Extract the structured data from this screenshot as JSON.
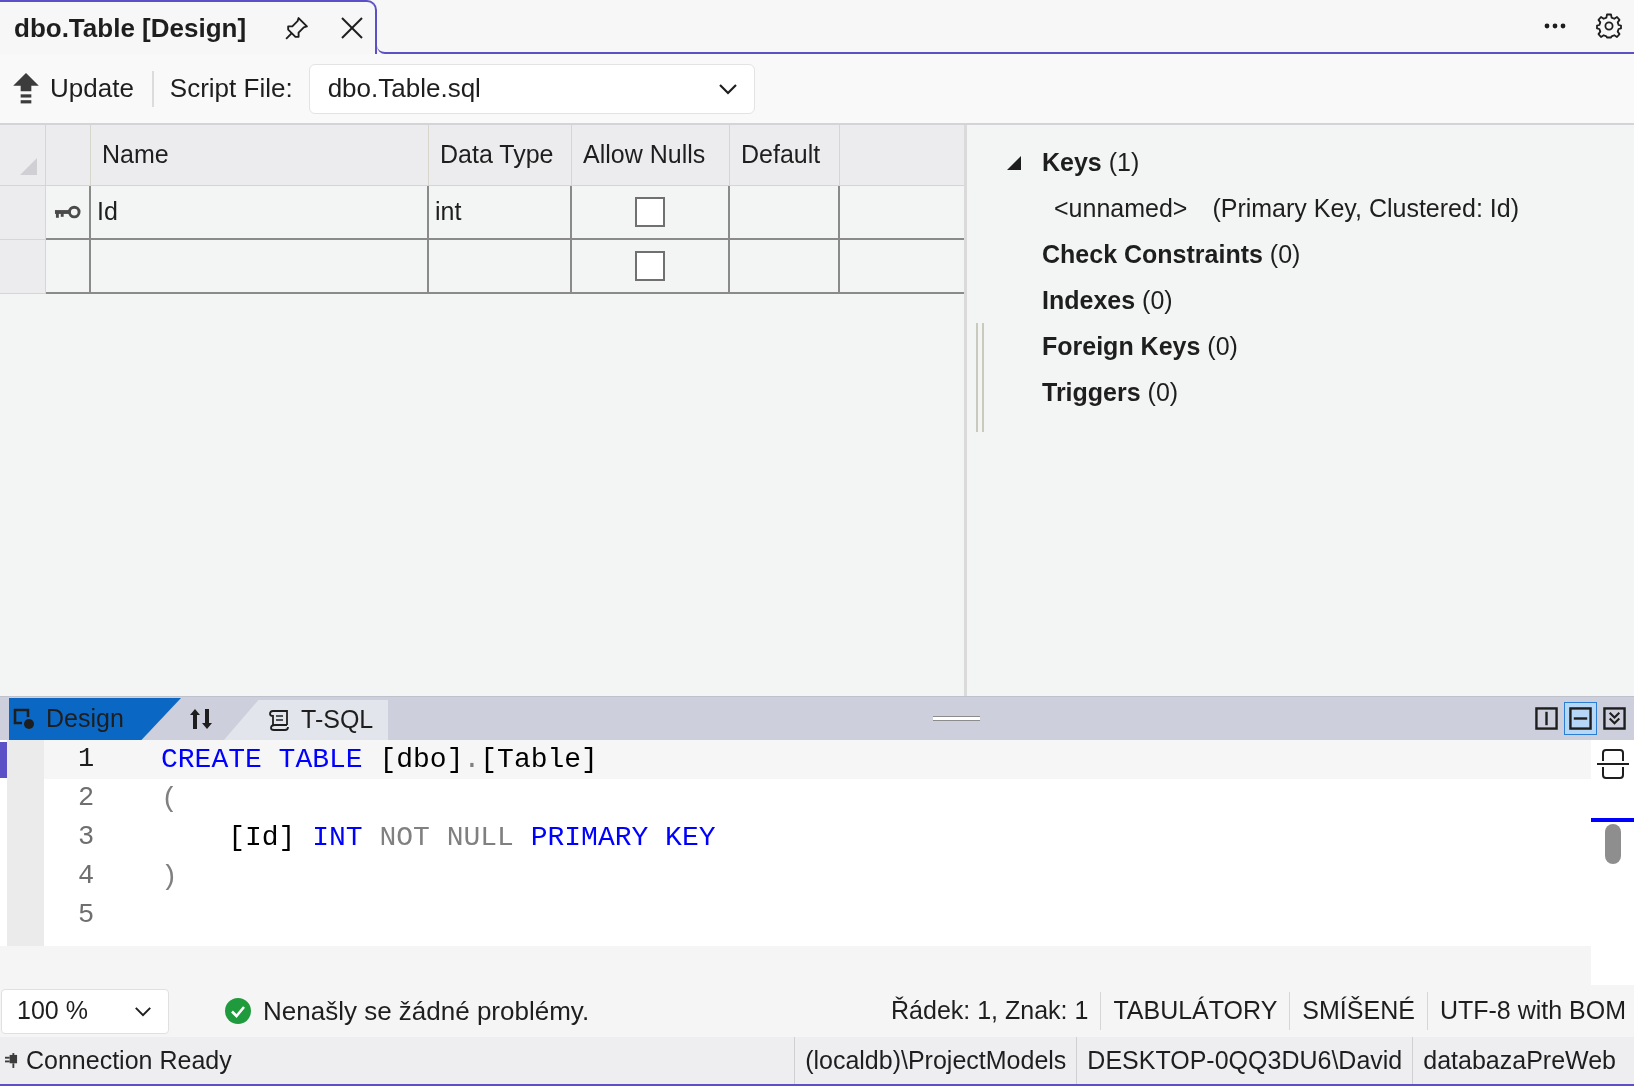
{
  "document_tab": {
    "title": "dbo.Table [Design]"
  },
  "toolbar": {
    "update_button": "Update",
    "script_file_label": "Script File:",
    "script_file": "dbo.Table.sql"
  },
  "grid": {
    "columns": [
      "Name",
      "Data Type",
      "Allow Nulls",
      "Default"
    ],
    "rows": [
      {
        "primary_key": true,
        "name": "Id",
        "data_type": "int",
        "allow_nulls": false
      },
      {
        "primary_key": false,
        "allow_nulls": false
      }
    ]
  },
  "properties_tree": {
    "items": [
      {
        "label": "Keys",
        "count": "(1)",
        "expanded": true,
        "children": [
          {
            "label": "<unnamed>",
            "detail": "(Primary Key, Clustered: Id)"
          }
        ]
      },
      {
        "label": "Check Constraints",
        "count": "(0)"
      },
      {
        "label": "Indexes",
        "count": "(0)"
      },
      {
        "label": "Foreign Keys",
        "count": "(0)"
      },
      {
        "label": "Triggers",
        "count": "(0)"
      }
    ]
  },
  "pane_tabs": [
    {
      "kind": "design",
      "label": "Design",
      "selected": true
    },
    {
      "kind": "tsql",
      "label": "T-SQL",
      "selected": false
    }
  ],
  "layout_buttons": [
    {
      "kind": "vertical",
      "selected": false
    },
    {
      "kind": "horizontal",
      "selected": true
    },
    {
      "kind": "collapse",
      "selected": false
    }
  ],
  "code_editor": {
    "lines": [
      {
        "number": "1",
        "current": true,
        "tokens": [
          {
            "kind": "keyword",
            "text": "CREATE TABLE"
          },
          {
            "kind": "plain",
            "text": " [dbo]"
          },
          {
            "kind": "gray",
            "text": "."
          },
          {
            "kind": "plain",
            "text": "[Table]"
          }
        ]
      },
      {
        "number": "2",
        "current": false,
        "tokens": [
          {
            "kind": "gray",
            "text": "("
          }
        ]
      },
      {
        "number": "3",
        "current": false,
        "tokens": [
          {
            "kind": "plain",
            "text": "    [Id] "
          },
          {
            "kind": "keyword",
            "text": "INT"
          },
          {
            "kind": "gray",
            "text": " NOT NULL "
          },
          {
            "kind": "keyword",
            "text": "PRIMARY KEY"
          }
        ]
      },
      {
        "number": "4",
        "current": false,
        "tokens": [
          {
            "kind": "gray",
            "text": ")"
          }
        ]
      },
      {
        "number": "5",
        "current": false
      }
    ]
  },
  "status_bar": {
    "zoom": "100 %",
    "issues": "Nenašly se žádné problémy.",
    "position": "Řádek: 1, Znak: 1",
    "indentation": "TABULÁTORY",
    "line_endings": "SMÍŠENÉ",
    "encoding": "UTF-8 with BOM"
  },
  "connection_bar": {
    "status": "Connection Ready",
    "server": "(localdb)\\ProjectModels",
    "user": "DESKTOP-0QQ3DU6\\David",
    "database": "databazaPreWeb"
  }
}
